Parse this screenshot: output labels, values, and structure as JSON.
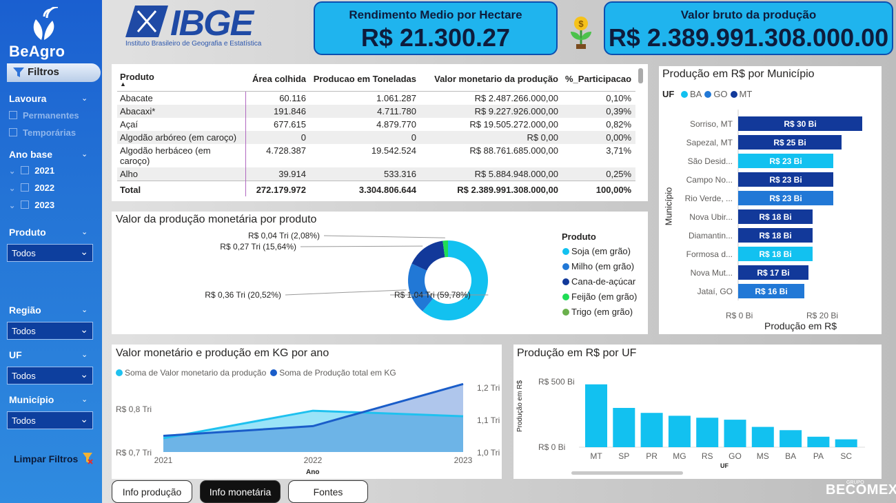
{
  "brand": {
    "logo_text": "BeAgro",
    "ibge_word": "IBGE",
    "ibge_sub": "Instituto Brasileiro de Geografia e Estatística",
    "footer_group": "GRUPO",
    "footer_brand": "BECOMEX"
  },
  "kpis": [
    {
      "title": "Rendimento Medio por Hectare",
      "value": "R$ 21.300.27"
    },
    {
      "title": "Valor bruto da produção",
      "value": "R$ 2.389.991.308.000.00"
    }
  ],
  "sidebar": {
    "filters_label": "Filtros",
    "lavoura_label": "Lavoura",
    "lavoura_options": [
      "Permanentes",
      "Temporárias"
    ],
    "ano_label": "Ano base",
    "anos": [
      "2021",
      "2022",
      "2023"
    ],
    "produto_label": "Produto",
    "produto_value": "Todos",
    "regiao_label": "Região",
    "regiao_value": "Todos",
    "uf_label": "UF",
    "uf_value": "Todos",
    "municipio_label": "Município",
    "municipio_value": "Todos",
    "limpar_label": "Limpar Filtros"
  },
  "table": {
    "headers": [
      "Produto",
      "Área colhida",
      "Producao em Toneladas",
      "Valor monetario da produção",
      "%_Participacao"
    ],
    "rows": [
      [
        "Abacate",
        "60.116",
        "1.061.287",
        "R$ 2.487.266.000,00",
        "0,10%"
      ],
      [
        "Abacaxi*",
        "191.846",
        "4.711.780",
        "R$ 9.227.926.000,00",
        "0,39%"
      ],
      [
        "Açaí",
        "677.615",
        "4.879.770",
        "R$ 19.505.272.000,00",
        "0,82%"
      ],
      [
        "Algodão arbóreo (em caroço)",
        "0",
        "0",
        "R$ 0,00",
        "0,00%"
      ],
      [
        "Algodão herbáceo (em caroço)",
        "4.728.387",
        "19.542.524",
        "R$ 88.761.685.000,00",
        "3,71%"
      ],
      [
        "Alho",
        "39.914",
        "533.316",
        "R$ 5.884.948.000,00",
        "0,25%"
      ]
    ],
    "total": [
      "Total",
      "272.179.972",
      "3.304.806.644",
      "R$ 2.389.991.308.000,00",
      "100,00%"
    ]
  },
  "donut": {
    "title": "Valor da produção monetária por produto",
    "legend_title": "Produto",
    "labels": [
      "R$ 1,04 Tri (59,78%)",
      "R$ 0,36 Tri (20,52%)",
      "R$ 0,27 Tri (15,64%)",
      "R$ 0,04 Tri (2,08%)"
    ],
    "colors": {
      "soja": "#12c1f0",
      "milho": "#2178d6",
      "cana": "#12399a",
      "feijao": "#1fdd55",
      "trigo": "#6ab04c"
    }
  },
  "combo": {
    "title": "Valor monetário e produção em KG por ano",
    "yleft_ticks": [
      "R$ 0,8 Tri",
      "R$ 0,7 Tri"
    ],
    "yright_ticks": [
      "1,2 Tri",
      "1,1 Tri",
      "1,0 Tri"
    ],
    "xlabel": "Ano"
  },
  "municipio_chart": {
    "title": "Produção em R$ por Município",
    "legend_title": "UF",
    "ylabel": "Município",
    "xlabel": "Produção em R$",
    "xticks": [
      "R$ 0 Bi",
      "R$ 20 Bi"
    ]
  },
  "uf_chart": {
    "title": "Produção em R$ por UF",
    "ylabel": "Produção em R$",
    "xlabel": "UF",
    "yticks": [
      "R$ 500 Bi",
      "R$ 0 Bi"
    ]
  },
  "tabs": [
    "Info produção",
    "Info monetária",
    "Fontes"
  ],
  "chart_data": [
    {
      "type": "pie",
      "title": "Valor da produção monetária por produto",
      "series": [
        {
          "name": "Soja (em grão)",
          "value": 1.04,
          "pct": 59.78,
          "label": "R$ 1,04 Tri (59,78%)",
          "color": "#12c1f0"
        },
        {
          "name": "Milho (em grão)",
          "value": 0.36,
          "pct": 20.52,
          "label": "R$ 0,36 Tri (20,52%)",
          "color": "#2178d6"
        },
        {
          "name": "Cana-de-açúcar",
          "value": 0.27,
          "pct": 15.64,
          "label": "R$ 0,27 Tri (15,64%)",
          "color": "#12399a"
        },
        {
          "name": "Feijão (em grão)",
          "value": 0.04,
          "pct": 2.08,
          "label": "R$ 0,04 Tri (2,08%)",
          "color": "#1fdd55"
        },
        {
          "name": "Trigo (em grão)",
          "value": 0.0,
          "pct": 0.0,
          "label": "",
          "color": "#6ab04c"
        }
      ]
    },
    {
      "type": "area",
      "title": "Valor monetário e produção em KG por ano",
      "xlabel": "Ano",
      "x": [
        "2021",
        "2022",
        "2023"
      ],
      "series": [
        {
          "name": "Soma de Valor monetario da produção",
          "values": [
            0.75,
            0.85,
            0.83
          ],
          "axis": "left",
          "unit": "Tri",
          "color": "#1fc1ef"
        },
        {
          "name": "Soma de Produção total em KG",
          "values": [
            1.05,
            1.08,
            1.21
          ],
          "axis": "right",
          "unit": "Tri",
          "color": "#1a5dc9"
        }
      ],
      "ylim_left": [
        0.7,
        0.9
      ],
      "ylim_right": [
        1.0,
        1.2
      ]
    },
    {
      "type": "bar",
      "title": "Produção em R$ por Município",
      "xlabel": "Produção em R$",
      "ylabel": "Município",
      "orientation": "horizontal",
      "legend": [
        {
          "name": "BA",
          "color": "#12c1f0"
        },
        {
          "name": "GO",
          "color": "#2178d6"
        },
        {
          "name": "MT",
          "color": "#12399a"
        }
      ],
      "categories": [
        "Sorriso, MT",
        "Sapezal, MT",
        "São Desid...",
        "Campo No...",
        "Rio Verde, ...",
        "Nova Ubir...",
        "Diamantin...",
        "Formosa d...",
        "Nova Mut...",
        "Jataí, GO"
      ],
      "values": [
        30,
        25,
        23,
        23,
        23,
        18,
        18,
        18,
        17,
        16
      ],
      "labels": [
        "R$ 30 Bi",
        "R$ 25 Bi",
        "R$ 23 Bi",
        "R$ 23 Bi",
        "R$ 23 Bi",
        "R$ 18 Bi",
        "R$ 18 Bi",
        "R$ 18 Bi",
        "R$ 17 Bi",
        "R$ 16 Bi"
      ],
      "colors": [
        "#12399a",
        "#12399a",
        "#12c1f0",
        "#12399a",
        "#2178d6",
        "#12399a",
        "#12399a",
        "#12c1f0",
        "#12399a",
        "#2178d6"
      ],
      "xlim": [
        0,
        30
      ]
    },
    {
      "type": "bar",
      "title": "Produção em R$ por UF",
      "xlabel": "UF",
      "ylabel": "Produção em R$",
      "categories": [
        "MT",
        "SP",
        "PR",
        "MG",
        "RS",
        "GO",
        "MS",
        "BA",
        "PA",
        "SC"
      ],
      "values": [
        480,
        300,
        262,
        240,
        225,
        210,
        155,
        130,
        80,
        60
      ],
      "ylim": [
        0,
        500
      ],
      "color": "#12c1f0"
    }
  ]
}
